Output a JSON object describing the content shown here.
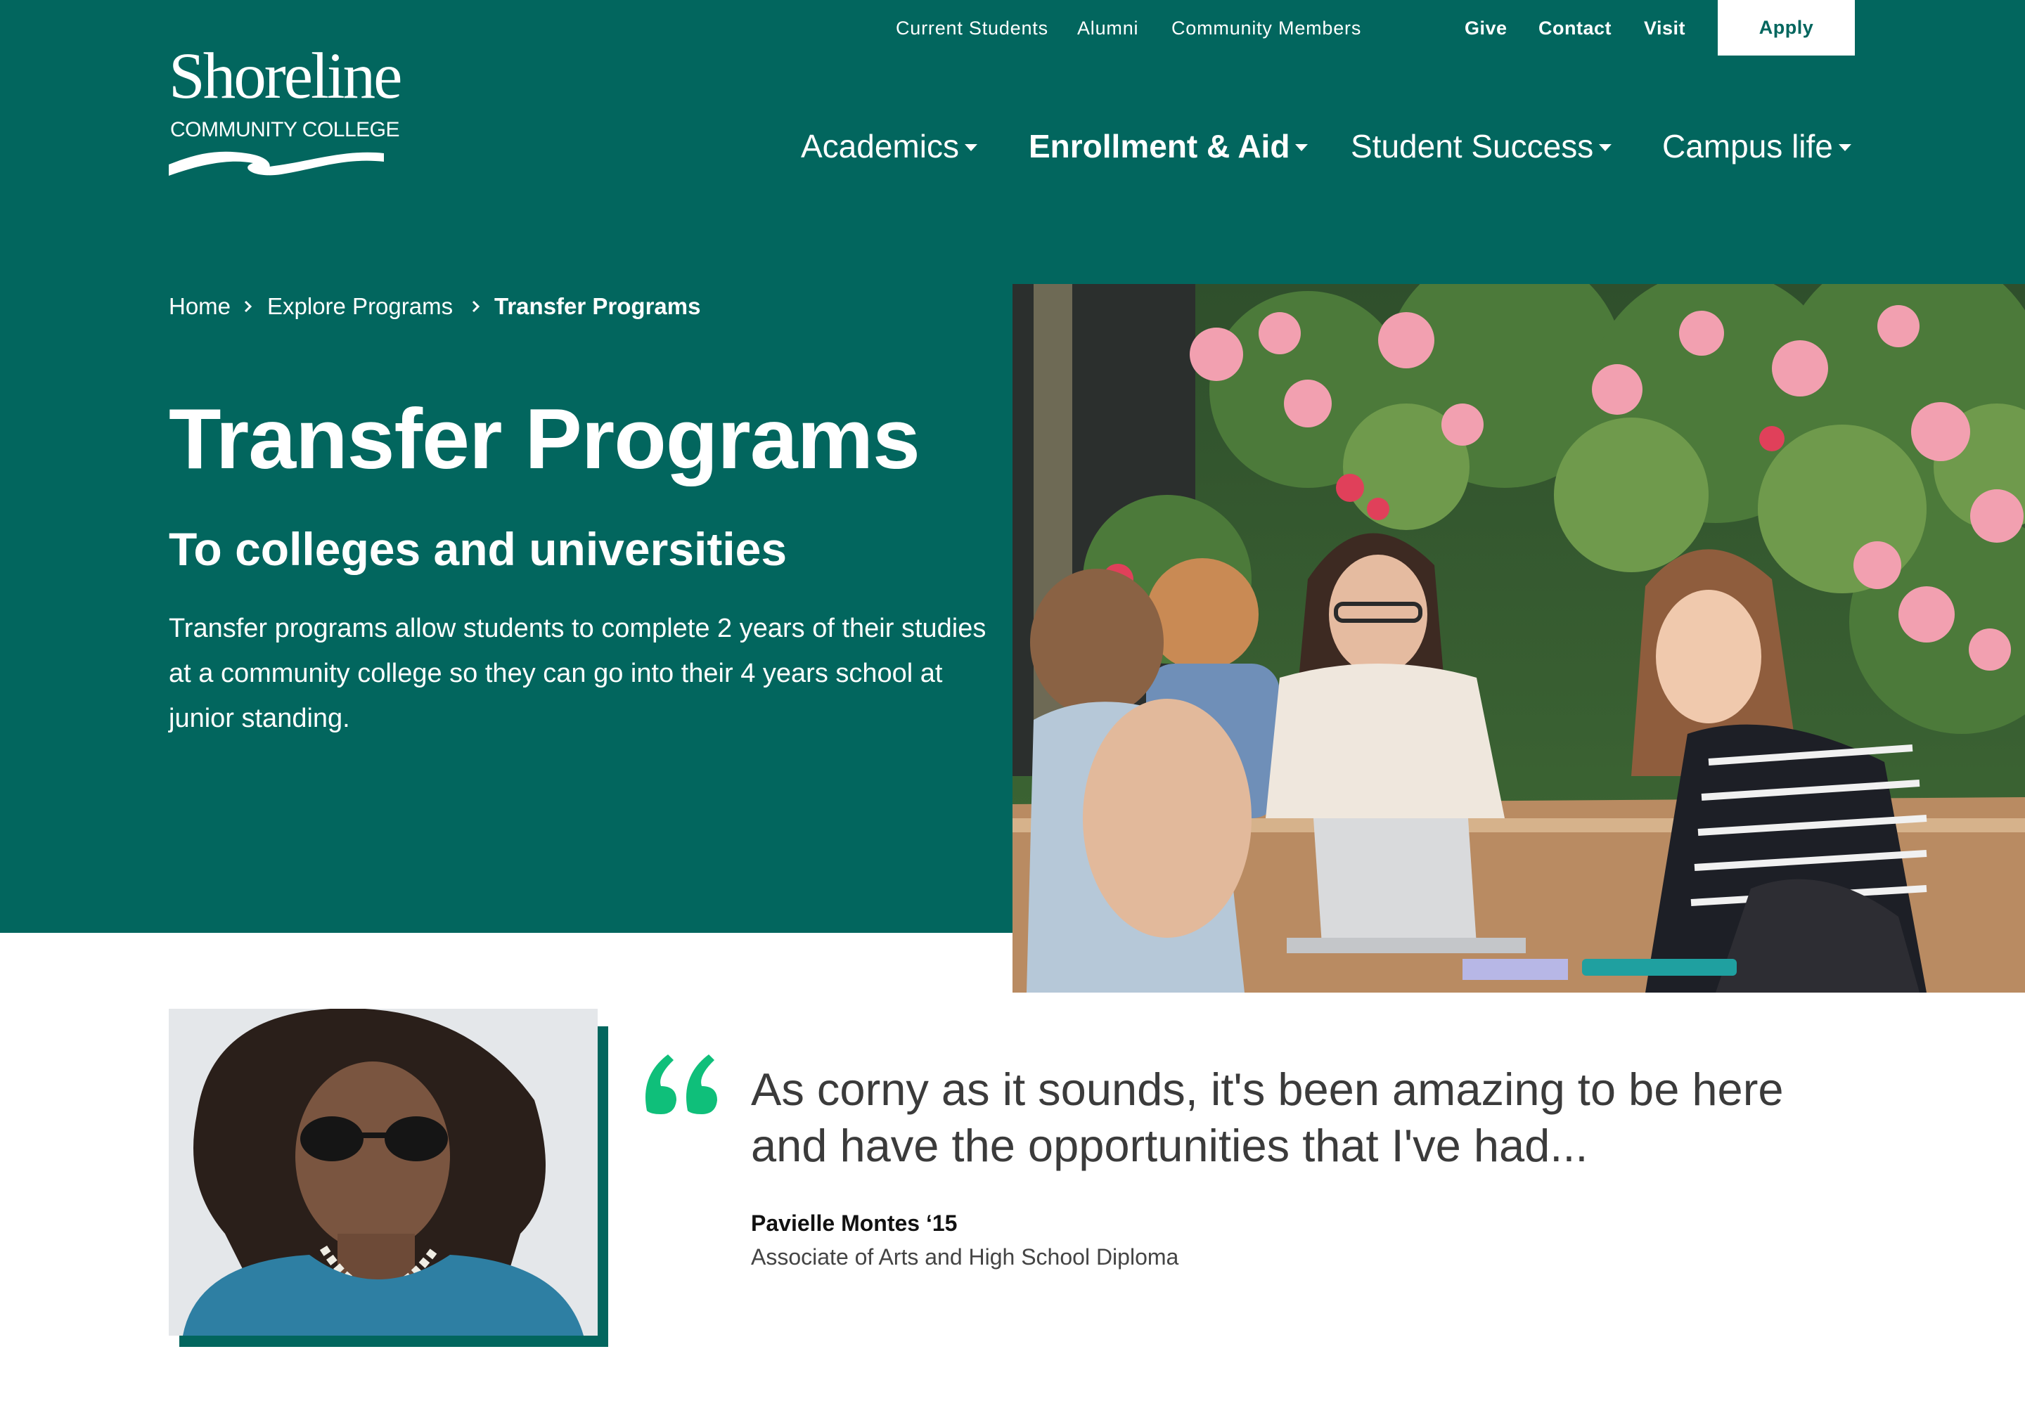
{
  "brand": {
    "name": "Shoreline",
    "subname": "COMMUNITY COLLEGE",
    "primary_color": "#02665e",
    "accent_color": "#0fbf7a"
  },
  "utility_nav": {
    "current_students": "Current Students",
    "alumni": "Alumni",
    "community_members": "Community Members",
    "give": "Give",
    "contact": "Contact",
    "visit": "Visit",
    "apply": "Apply"
  },
  "main_nav": {
    "academics": "Academics",
    "enrollment": "Enrollment & Aid",
    "student_success": "Student Success",
    "campus_life": "Campus life"
  },
  "breadcrumb": {
    "home": "Home",
    "explore": "Explore Programs",
    "current": "Transfer Programs"
  },
  "hero": {
    "title": "Transfer Programs",
    "subtitle": "To colleges and universities",
    "body": "Transfer programs allow students to complete 2 years of their studies at a community college so they can go into their 4 years school at junior standing.",
    "image_alt": "Students studying at an outdoor table"
  },
  "testimonial": {
    "quote": "As corny as it sounds, it's been amazing to be here and have the opportunities that I've had...",
    "author": "Pavielle Montes ‘15",
    "role": "Associate of Arts and High School Diploma",
    "portrait_alt": "Portrait of Pavielle Montes"
  }
}
